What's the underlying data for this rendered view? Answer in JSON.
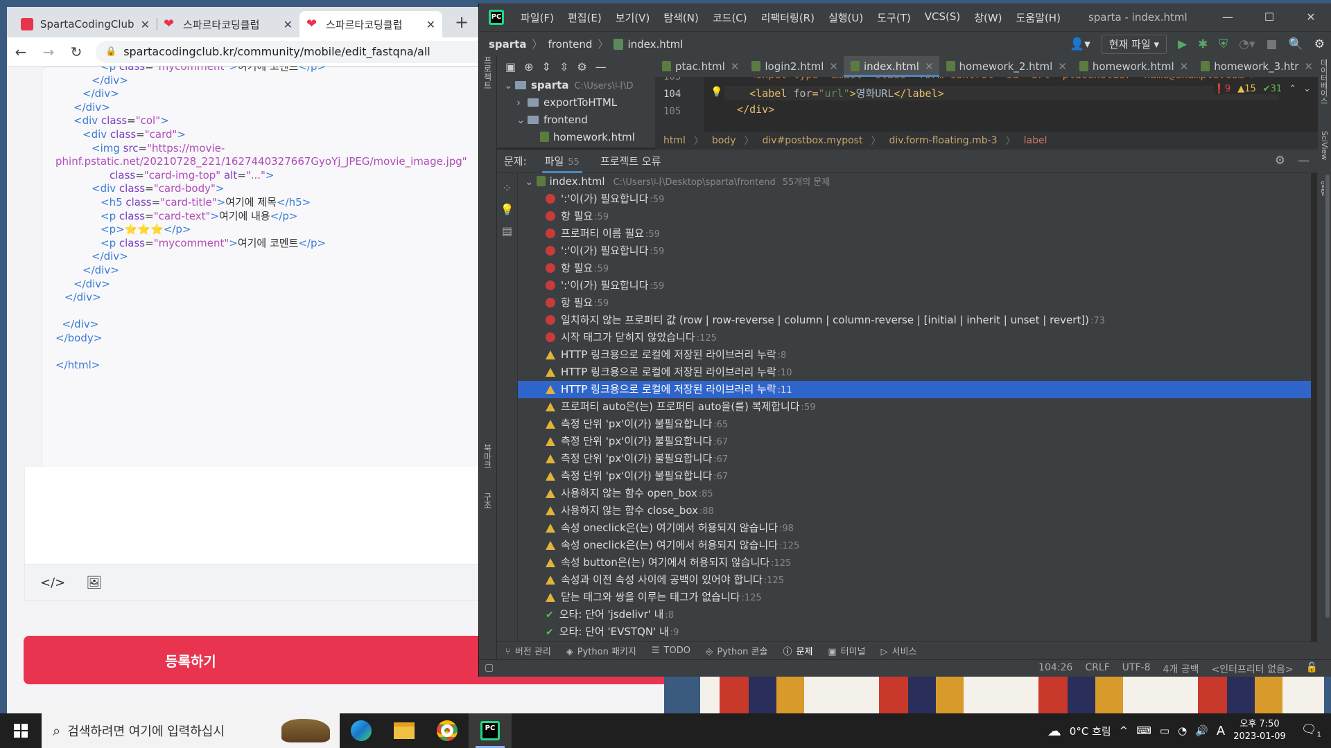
{
  "browser": {
    "tabs": [
      {
        "title": "SpartaCodingClub",
        "active": false
      },
      {
        "title": "스파르타코딩클럽",
        "active": false
      },
      {
        "title": "스파르타코딩클럽",
        "active": true
      }
    ],
    "url": "spartacodingclub.kr/community/mobile/edit_fastqna/all",
    "code_lines": [
      {
        "indent": 5,
        "parts": [
          [
            "tg",
            "<p "
          ],
          [
            "at",
            "class"
          ],
          [
            "tx",
            "="
          ],
          [
            "av",
            "\"mycomment\""
          ],
          [
            "tg",
            ">"
          ],
          [
            "tx",
            "여기에 코멘트"
          ],
          [
            "tg",
            "</p>"
          ]
        ]
      },
      {
        "indent": 4,
        "parts": [
          [
            "tg",
            "</div>"
          ]
        ]
      },
      {
        "indent": 3,
        "parts": [
          [
            "tg",
            "</div>"
          ]
        ]
      },
      {
        "indent": 2,
        "parts": [
          [
            "tg",
            "</div>"
          ]
        ]
      },
      {
        "indent": 2,
        "parts": [
          [
            "tg",
            "<div "
          ],
          [
            "at",
            "class"
          ],
          [
            "tx",
            "="
          ],
          [
            "av",
            "\"col\""
          ],
          [
            "tg",
            ">"
          ]
        ]
      },
      {
        "indent": 3,
        "parts": [
          [
            "tg",
            "<div "
          ],
          [
            "at",
            "class"
          ],
          [
            "tx",
            "="
          ],
          [
            "av",
            "\"card\""
          ],
          [
            "tg",
            ">"
          ]
        ]
      },
      {
        "indent": 4,
        "parts": [
          [
            "tg",
            "<img "
          ],
          [
            "at",
            "src"
          ],
          [
            "tx",
            "="
          ],
          [
            "av",
            "\"https://movie-"
          ]
        ]
      },
      {
        "indent": 0,
        "parts": [
          [
            "av",
            "phinf.pstatic.net/20210728_221/1627440327667GyoYj_JPEG/movie_image.jpg\""
          ]
        ]
      },
      {
        "indent": 6,
        "parts": [
          [
            "at",
            "class"
          ],
          [
            "tx",
            "="
          ],
          [
            "av",
            "\"card-img-top\" "
          ],
          [
            "at",
            "alt"
          ],
          [
            "tx",
            "="
          ],
          [
            "av",
            "\"...\""
          ],
          [
            "tg",
            ">"
          ]
        ]
      },
      {
        "indent": 4,
        "parts": [
          [
            "tg",
            "<div "
          ],
          [
            "at",
            "class"
          ],
          [
            "tx",
            "="
          ],
          [
            "av",
            "\"card-body\""
          ],
          [
            "tg",
            ">"
          ]
        ]
      },
      {
        "indent": 5,
        "parts": [
          [
            "tg",
            "<h5 "
          ],
          [
            "at",
            "class"
          ],
          [
            "tx",
            "="
          ],
          [
            "av",
            "\"card-title\""
          ],
          [
            "tg",
            ">"
          ],
          [
            "tx",
            "여기에 제목"
          ],
          [
            "tg",
            "</h5>"
          ]
        ]
      },
      {
        "indent": 5,
        "parts": [
          [
            "tg",
            "<p "
          ],
          [
            "at",
            "class"
          ],
          [
            "tx",
            "="
          ],
          [
            "av",
            "\"card-text\""
          ],
          [
            "tg",
            ">"
          ],
          [
            "tx",
            "여기에 내용"
          ],
          [
            "tg",
            "</p>"
          ]
        ]
      },
      {
        "indent": 5,
        "parts": [
          [
            "tg",
            "<p>"
          ],
          [
            "tx",
            "⭐⭐⭐"
          ],
          [
            "tg",
            "</p>"
          ]
        ]
      },
      {
        "indent": 5,
        "parts": [
          [
            "tg",
            "<p "
          ],
          [
            "at",
            "class"
          ],
          [
            "tx",
            "="
          ],
          [
            "av",
            "\"mycomment\""
          ],
          [
            "tg",
            ">"
          ],
          [
            "tx",
            "여기에 코멘트"
          ],
          [
            "tg",
            "</p>"
          ]
        ]
      },
      {
        "indent": 4,
        "parts": [
          [
            "tg",
            "</div>"
          ]
        ]
      },
      {
        "indent": 3,
        "parts": [
          [
            "tg",
            "</div>"
          ]
        ]
      },
      {
        "indent": 2,
        "parts": [
          [
            "tg",
            "</div>"
          ]
        ]
      },
      {
        "indent": 1,
        "parts": [
          [
            "tg",
            "</div>"
          ]
        ]
      },
      {
        "indent": 0,
        "parts": []
      },
      {
        "indent": 0,
        "parts": [
          [
            "tg",
            "  </div>"
          ]
        ]
      },
      {
        "indent": 0,
        "parts": [
          [
            "tg",
            "</body>"
          ]
        ]
      },
      {
        "indent": 0,
        "parts": []
      },
      {
        "indent": 0,
        "parts": [
          [
            "tg",
            "</html>"
          ]
        ]
      }
    ],
    "submit_label": "등록하기"
  },
  "ide": {
    "menu": [
      "파일(F)",
      "편집(E)",
      "보기(V)",
      "탐색(N)",
      "코드(C)",
      "리팩터링(R)",
      "실행(U)",
      "도구(T)",
      "VCS(S)",
      "창(W)",
      "도움말(H)"
    ],
    "window_title": "sparta - index.html",
    "breadcrumb": [
      "sparta",
      "frontend",
      "index.html"
    ],
    "scope": "현재 파일",
    "tree": [
      {
        "name": "sparta",
        "path": "C:\\Users\\나\\D",
        "depth": 0,
        "arrow": "⌄"
      },
      {
        "name": "exportToHTML",
        "depth": 1,
        "arrow": "›"
      },
      {
        "name": "frontend",
        "depth": 1,
        "arrow": "⌄"
      },
      {
        "name": "homework.html",
        "depth": 2,
        "arrow": ""
      }
    ],
    "editor_tabs": [
      {
        "name": "ptac.html",
        "active": false
      },
      {
        "name": "login2.html",
        "active": false
      },
      {
        "name": "index.html",
        "active": true
      },
      {
        "name": "homework_2.html",
        "active": false
      },
      {
        "name": "homework.html",
        "active": false
      },
      {
        "name": "homework_3.htr",
        "active": false
      }
    ],
    "gutter": [
      "103",
      "104",
      "105"
    ],
    "inspect": {
      "errors": "9",
      "warnings": "15",
      "typos": "31"
    },
    "code_crumbs": [
      "html",
      "body",
      "div#postbox.mypost",
      "div.form-floating.mb-3",
      "label"
    ],
    "problems": {
      "label": "문제:",
      "tab_file": "파일",
      "tab_file_count": "55",
      "tab_project": "프로젝트 오류",
      "file": "index.html",
      "file_path": "C:\\Users\\나\\Desktop\\sparta\\frontend",
      "file_summary": "55개의 문제",
      "items": [
        {
          "sev": "error",
          "msg": "':'이(가) 필요합니다",
          "line": ":59"
        },
        {
          "sev": "error",
          "msg": "항 필요",
          "line": ":59"
        },
        {
          "sev": "error",
          "msg": "프로퍼티 이름 필요",
          "line": ":59"
        },
        {
          "sev": "error",
          "msg": "':'이(가) 필요합니다",
          "line": ":59"
        },
        {
          "sev": "error",
          "msg": "항 필요",
          "line": ":59"
        },
        {
          "sev": "error",
          "msg": "':'이(가) 필요합니다",
          "line": ":59"
        },
        {
          "sev": "error",
          "msg": "항 필요",
          "line": ":59"
        },
        {
          "sev": "error",
          "msg": "일치하지 않는 프로퍼티 값 (row | row-reverse | column | column-reverse | [initial | inherit | unset | revert])",
          "line": ":73"
        },
        {
          "sev": "error",
          "msg": "시작 태그가 닫히지 않았습니다",
          "line": ":125"
        },
        {
          "sev": "warn",
          "msg": "HTTP 링크용으로 로컬에 저장된 라이브러리 누락",
          "line": ":8"
        },
        {
          "sev": "warn",
          "msg": "HTTP 링크용으로 로컬에 저장된 라이브러리 누락",
          "line": ":10"
        },
        {
          "sev": "warn",
          "msg": "HTTP 링크용으로 로컬에 저장된 라이브러리 누락",
          "line": ":11",
          "selected": true
        },
        {
          "sev": "warn",
          "msg": "프로퍼티 auto은(는) 프로퍼티 auto을(를) 복제합니다",
          "line": ":59"
        },
        {
          "sev": "warn",
          "msg": "측정 단위 'px'이(가) 불필요합니다",
          "line": ":65"
        },
        {
          "sev": "warn",
          "msg": "측정 단위 'px'이(가) 불필요합니다",
          "line": ":67"
        },
        {
          "sev": "warn",
          "msg": "측정 단위 'px'이(가) 불필요합니다",
          "line": ":67"
        },
        {
          "sev": "warn",
          "msg": "측정 단위 'px'이(가) 불필요합니다",
          "line": ":67"
        },
        {
          "sev": "warn",
          "msg": "사용하지 않는 함수 open_box",
          "line": ":85"
        },
        {
          "sev": "warn",
          "msg": "사용하지 않는 함수 close_box",
          "line": ":88"
        },
        {
          "sev": "warn",
          "msg": "속성 oneclick은(는) 여기에서 허용되지 않습니다",
          "line": ":98"
        },
        {
          "sev": "warn",
          "msg": "속성 oneclick은(는) 여기에서 허용되지 않습니다",
          "line": ":125"
        },
        {
          "sev": "warn",
          "msg": "속성 button은(는) 여기에서 허용되지 않습니다",
          "line": ":125"
        },
        {
          "sev": "warn",
          "msg": "속성과 이전 속성 사이에 공백이 있어야 합니다",
          "line": ":125"
        },
        {
          "sev": "warn",
          "msg": "닫는 태그와 쌍을 이루는 태그가 없습니다",
          "line": ":125"
        },
        {
          "sev": "typo",
          "msg": "오타: 단어 'jsdelivr' 내",
          "line": ":8"
        },
        {
          "sev": "typo",
          "msg": "오타: 단어 'EVSTQN' 내",
          "line": ":9"
        }
      ]
    },
    "tool_windows": [
      "버전 관리",
      "Python 패키지",
      "TODO",
      "Python 콘솔",
      "문제",
      "터미널",
      "서비스"
    ],
    "active_tool_window": "문제",
    "status": [
      "104:26",
      "CRLF",
      "UTF-8",
      "4개 공백",
      "<인터프리터 없음>"
    ],
    "left_strip_labels": [
      "프로젝트",
      "북마크",
      "구조"
    ],
    "right_strip_labels": [
      "데이터베이스",
      "SciView",
      "알림"
    ]
  },
  "taskbar": {
    "search_placeholder": "검색하려면 여기에 입력하십시",
    "weather": "0°C 흐림",
    "time": "오후 7:50",
    "date": "2023-01-09",
    "ime": "A",
    "notifications": "1"
  }
}
